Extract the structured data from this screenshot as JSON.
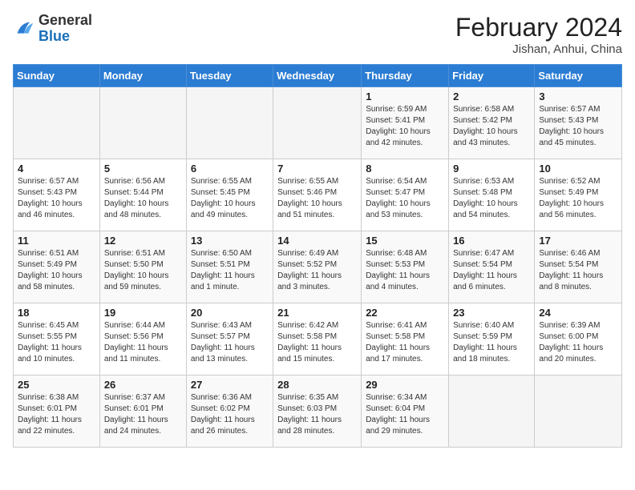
{
  "header": {
    "logo_general": "General",
    "logo_blue": "Blue",
    "title": "February 2024",
    "location": "Jishan, Anhui, China"
  },
  "days_of_week": [
    "Sunday",
    "Monday",
    "Tuesday",
    "Wednesday",
    "Thursday",
    "Friday",
    "Saturday"
  ],
  "weeks": [
    [
      {
        "day": "",
        "info": ""
      },
      {
        "day": "",
        "info": ""
      },
      {
        "day": "",
        "info": ""
      },
      {
        "day": "",
        "info": ""
      },
      {
        "day": "1",
        "info": "Sunrise: 6:59 AM\nSunset: 5:41 PM\nDaylight: 10 hours\nand 42 minutes."
      },
      {
        "day": "2",
        "info": "Sunrise: 6:58 AM\nSunset: 5:42 PM\nDaylight: 10 hours\nand 43 minutes."
      },
      {
        "day": "3",
        "info": "Sunrise: 6:57 AM\nSunset: 5:43 PM\nDaylight: 10 hours\nand 45 minutes."
      }
    ],
    [
      {
        "day": "4",
        "info": "Sunrise: 6:57 AM\nSunset: 5:43 PM\nDaylight: 10 hours\nand 46 minutes."
      },
      {
        "day": "5",
        "info": "Sunrise: 6:56 AM\nSunset: 5:44 PM\nDaylight: 10 hours\nand 48 minutes."
      },
      {
        "day": "6",
        "info": "Sunrise: 6:55 AM\nSunset: 5:45 PM\nDaylight: 10 hours\nand 49 minutes."
      },
      {
        "day": "7",
        "info": "Sunrise: 6:55 AM\nSunset: 5:46 PM\nDaylight: 10 hours\nand 51 minutes."
      },
      {
        "day": "8",
        "info": "Sunrise: 6:54 AM\nSunset: 5:47 PM\nDaylight: 10 hours\nand 53 minutes."
      },
      {
        "day": "9",
        "info": "Sunrise: 6:53 AM\nSunset: 5:48 PM\nDaylight: 10 hours\nand 54 minutes."
      },
      {
        "day": "10",
        "info": "Sunrise: 6:52 AM\nSunset: 5:49 PM\nDaylight: 10 hours\nand 56 minutes."
      }
    ],
    [
      {
        "day": "11",
        "info": "Sunrise: 6:51 AM\nSunset: 5:49 PM\nDaylight: 10 hours\nand 58 minutes."
      },
      {
        "day": "12",
        "info": "Sunrise: 6:51 AM\nSunset: 5:50 PM\nDaylight: 10 hours\nand 59 minutes."
      },
      {
        "day": "13",
        "info": "Sunrise: 6:50 AM\nSunset: 5:51 PM\nDaylight: 11 hours\nand 1 minute."
      },
      {
        "day": "14",
        "info": "Sunrise: 6:49 AM\nSunset: 5:52 PM\nDaylight: 11 hours\nand 3 minutes."
      },
      {
        "day": "15",
        "info": "Sunrise: 6:48 AM\nSunset: 5:53 PM\nDaylight: 11 hours\nand 4 minutes."
      },
      {
        "day": "16",
        "info": "Sunrise: 6:47 AM\nSunset: 5:54 PM\nDaylight: 11 hours\nand 6 minutes."
      },
      {
        "day": "17",
        "info": "Sunrise: 6:46 AM\nSunset: 5:54 PM\nDaylight: 11 hours\nand 8 minutes."
      }
    ],
    [
      {
        "day": "18",
        "info": "Sunrise: 6:45 AM\nSunset: 5:55 PM\nDaylight: 11 hours\nand 10 minutes."
      },
      {
        "day": "19",
        "info": "Sunrise: 6:44 AM\nSunset: 5:56 PM\nDaylight: 11 hours\nand 11 minutes."
      },
      {
        "day": "20",
        "info": "Sunrise: 6:43 AM\nSunset: 5:57 PM\nDaylight: 11 hours\nand 13 minutes."
      },
      {
        "day": "21",
        "info": "Sunrise: 6:42 AM\nSunset: 5:58 PM\nDaylight: 11 hours\nand 15 minutes."
      },
      {
        "day": "22",
        "info": "Sunrise: 6:41 AM\nSunset: 5:58 PM\nDaylight: 11 hours\nand 17 minutes."
      },
      {
        "day": "23",
        "info": "Sunrise: 6:40 AM\nSunset: 5:59 PM\nDaylight: 11 hours\nand 18 minutes."
      },
      {
        "day": "24",
        "info": "Sunrise: 6:39 AM\nSunset: 6:00 PM\nDaylight: 11 hours\nand 20 minutes."
      }
    ],
    [
      {
        "day": "25",
        "info": "Sunrise: 6:38 AM\nSunset: 6:01 PM\nDaylight: 11 hours\nand 22 minutes."
      },
      {
        "day": "26",
        "info": "Sunrise: 6:37 AM\nSunset: 6:01 PM\nDaylight: 11 hours\nand 24 minutes."
      },
      {
        "day": "27",
        "info": "Sunrise: 6:36 AM\nSunset: 6:02 PM\nDaylight: 11 hours\nand 26 minutes."
      },
      {
        "day": "28",
        "info": "Sunrise: 6:35 AM\nSunset: 6:03 PM\nDaylight: 11 hours\nand 28 minutes."
      },
      {
        "day": "29",
        "info": "Sunrise: 6:34 AM\nSunset: 6:04 PM\nDaylight: 11 hours\nand 29 minutes."
      },
      {
        "day": "",
        "info": ""
      },
      {
        "day": "",
        "info": ""
      }
    ]
  ]
}
